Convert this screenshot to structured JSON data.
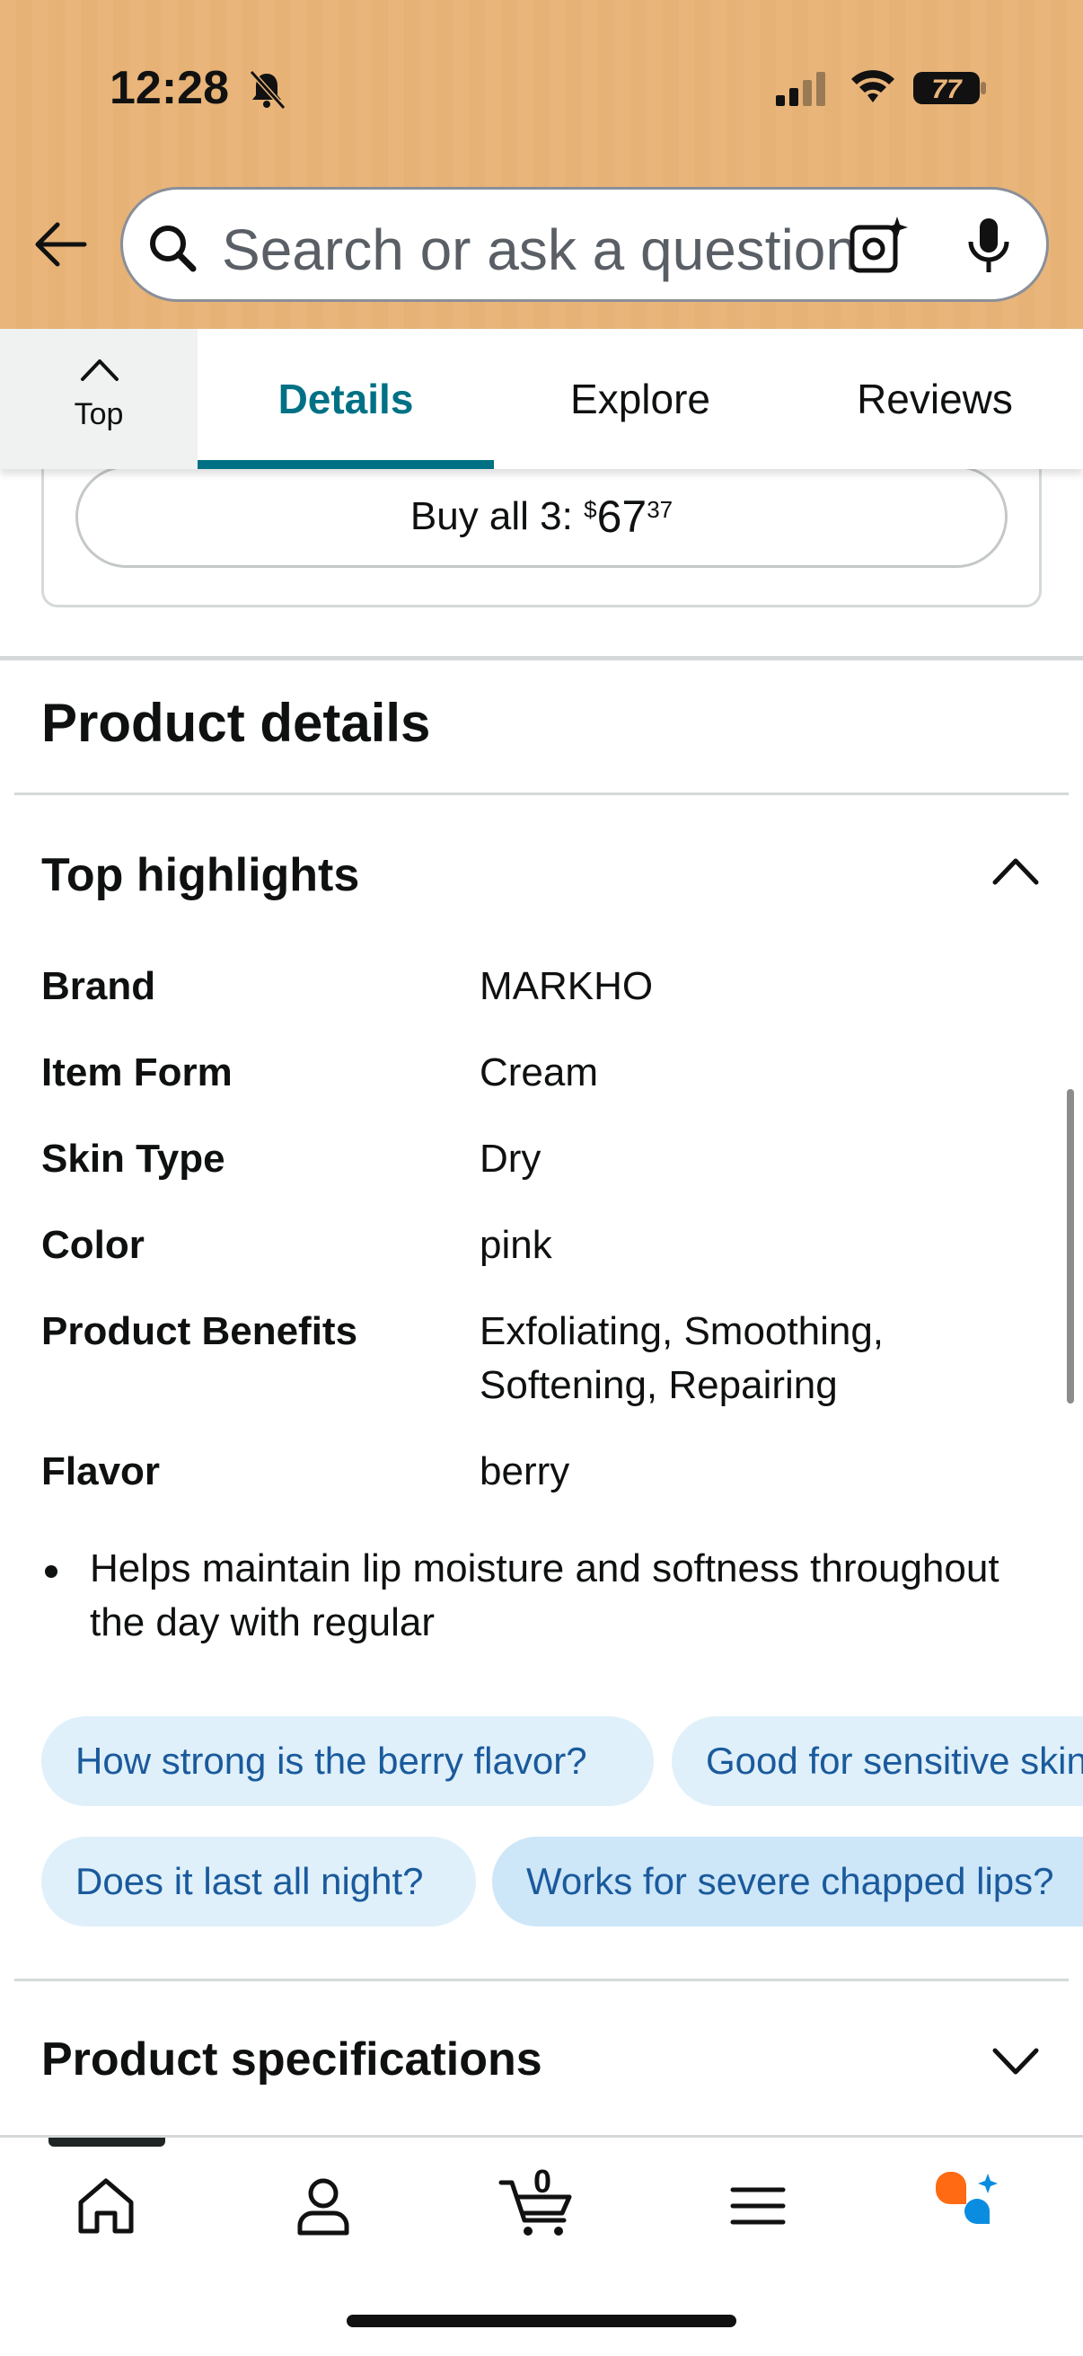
{
  "status_bar": {
    "time": "12:28",
    "battery": "77"
  },
  "search": {
    "placeholder": "Search or ask a question"
  },
  "tabs": {
    "top_label": "Top",
    "details": "Details",
    "explore": "Explore",
    "reviews": "Reviews"
  },
  "buy_all": {
    "prefix": "Buy all 3: ",
    "currency": "$",
    "dollars": "67",
    "cents": "37"
  },
  "product_details": {
    "title": "Product details"
  },
  "top_highlights": {
    "title": "Top highlights",
    "rows": [
      {
        "key": "Brand",
        "value": "MARKHO"
      },
      {
        "key": "Item Form",
        "value": "Cream"
      },
      {
        "key": "Skin Type",
        "value": "Dry"
      },
      {
        "key": "Color",
        "value": "pink"
      },
      {
        "key": "Product Benefits",
        "value": "Exfoliating, Smoothing, Softening, Repairing"
      },
      {
        "key": "Flavor",
        "value": "berry"
      }
    ],
    "bullet": "Helps maintain lip moisture and softness throughout the day with regular"
  },
  "question_chips": [
    "How strong is the berry flavor?",
    "Good for sensitive skin?",
    "Does it last all night?",
    "Works for severe chapped lips?"
  ],
  "product_specifications": {
    "title": "Product specifications"
  },
  "bottom_nav": {
    "cart_count": "0",
    "items": [
      "home-icon",
      "account-icon",
      "cart-icon",
      "menu-icon",
      "rufus-ai-icon"
    ]
  },
  "colors": {
    "header_bg": "#e9b57a",
    "accent_teal": "#007185",
    "chip_bg": "#dff0fa",
    "chip_text": "#1a5a9c",
    "rufus_orange": "#ff6a13",
    "rufus_blue": "#0a8de0"
  }
}
